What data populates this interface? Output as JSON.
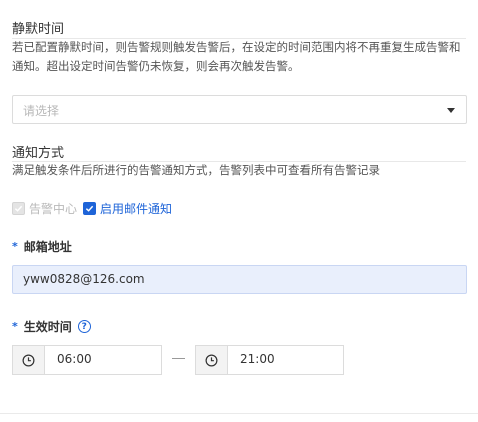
{
  "silence": {
    "title": "静默时间",
    "desc": "若已配置静默时间，则告警规则触发告警后，在设定的时间范围内将不再重复生成告警和通知。超出设定时间告警仍未恢复，则会再次触发告警。",
    "select_placeholder": "请选择"
  },
  "notify": {
    "title": "通知方式",
    "desc": "满足触发条件后所进行的告警通知方式，告警列表中可查看所有告警记录",
    "options": [
      {
        "label": "告警中心",
        "checked": true,
        "disabled": true
      },
      {
        "label": "启用邮件通知",
        "checked": true,
        "disabled": false
      }
    ]
  },
  "email": {
    "required_mark": "*",
    "label": "邮箱地址",
    "value": "yww0828@126.com"
  },
  "effective": {
    "required_mark": "*",
    "label": "生效时间",
    "help": "?",
    "start": "06:00",
    "end": "21:00"
  },
  "colors": {
    "primary": "#1e64d8",
    "input_highlight": "#e9effc"
  },
  "icons": {
    "select_caret": "caret-down-icon",
    "clock": "clock-icon",
    "help": "help-circle-icon",
    "check": "check-icon"
  }
}
